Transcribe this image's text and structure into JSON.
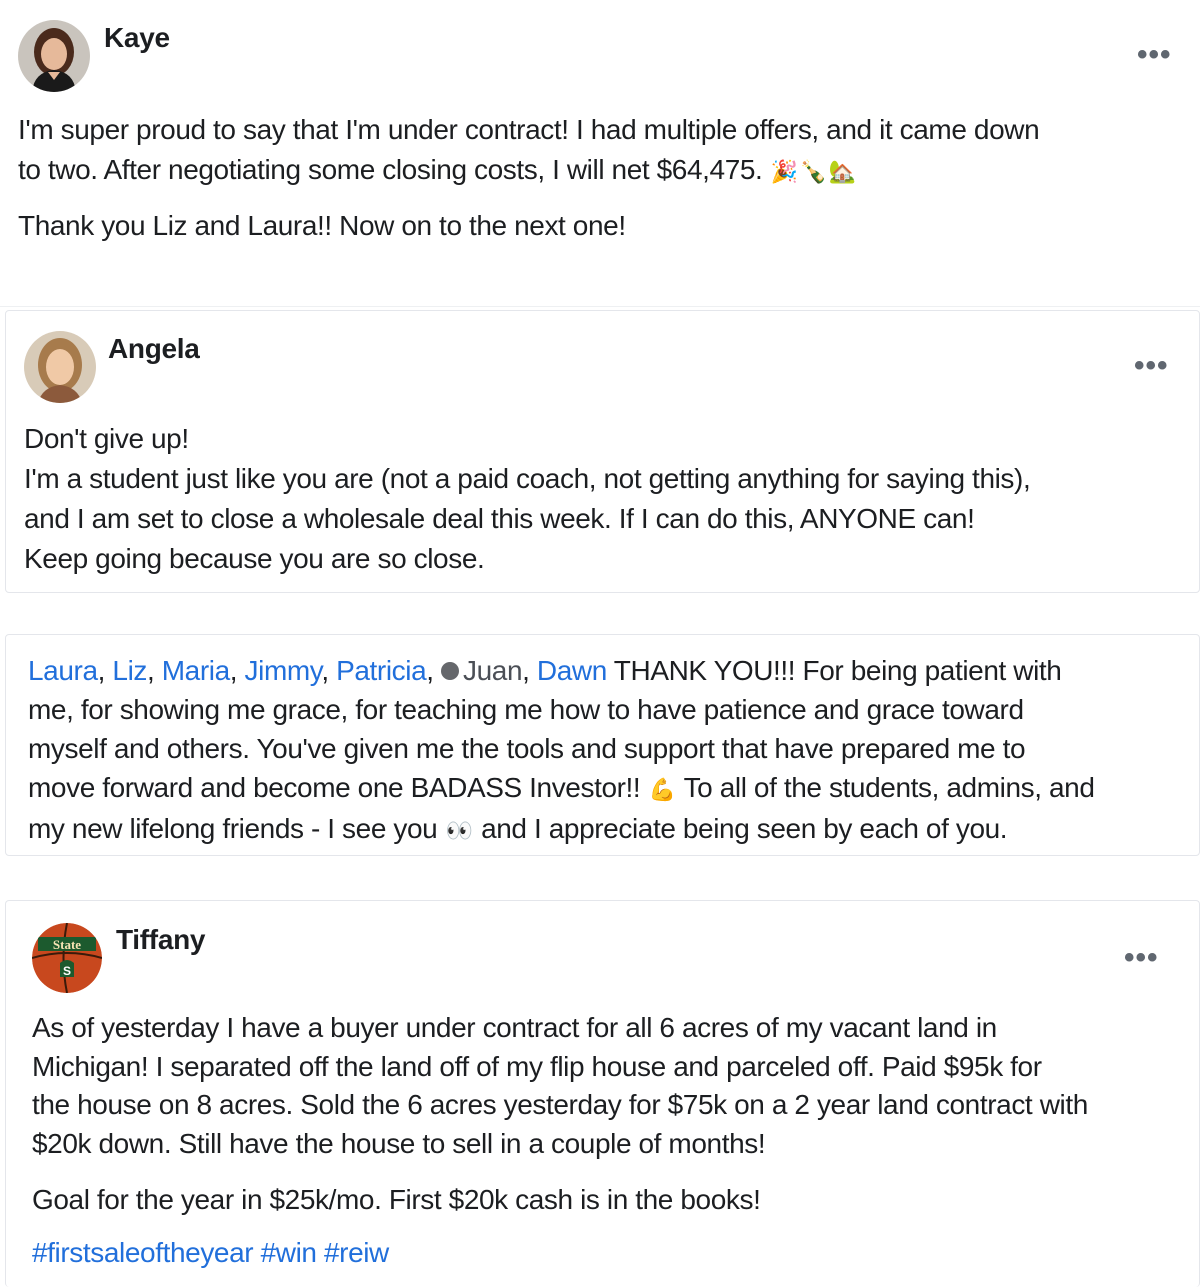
{
  "posts": [
    {
      "author": "Kaye",
      "more_label": "•••",
      "text_lines": [
        "I'm super proud to say that I'm under contract!  I had multiple offers, and it came down",
        "to two. After negotiating some closing costs, I will net $64,475. ",
        "Thank you Liz and Laura!! Now on to the next one!"
      ],
      "emojis": [
        "🎉",
        "🍾",
        "🏡"
      ]
    },
    {
      "author": "Angela",
      "more_label": "•••",
      "text_lines": [
        "Don't give up!",
        "I'm a student just like you are (not a paid coach, not getting anything for saying this),",
        "and I am set to close a wholesale deal this week. If I can do this, ANYONE can!",
        "Keep going because you are so close."
      ]
    },
    {
      "mentions": [
        "Laura",
        "Liz",
        "Maria",
        "Jimmy",
        "Patricia",
        "Juan",
        "Dawn"
      ],
      "separator": ", ",
      "line1_rest": " THANK YOU!!!  For being patient with",
      "text_lines": [
        "me, for showing me grace, for teaching me how to have patience and grace toward",
        "myself and others.  You've given me the tools and support that have prepared me to",
        "move forward and become one BADASS Investor!! ",
        " To all of the students, admins, and",
        "my new lifelong friends - I see you ",
        " and I appreciate being seen by each of you."
      ],
      "emojis": [
        "💪",
        "👀"
      ]
    },
    {
      "author": "Tiffany",
      "more_label": "•••",
      "text_lines": [
        "As of yesterday I have a buyer under contract for all 6 acres of my vacant land in",
        "Michigan!  I separated off the land off of my flip house and parceled off.  Paid $95k for",
        "the house on 8 acres.  Sold the 6 acres yesterday for $75k on a 2 year land contract with",
        "$20k down.  Still have the house to sell in a couple of months!",
        "Goal for the year in $25k/mo.  First $20k cash is in the books!"
      ],
      "hashtags": [
        "#firstsaleoftheyear",
        "#win",
        "#reiw"
      ],
      "avatar_badge": "State"
    }
  ],
  "colors": {
    "link": "#216fdb",
    "text": "#1c1e21",
    "muted": "#606770"
  }
}
